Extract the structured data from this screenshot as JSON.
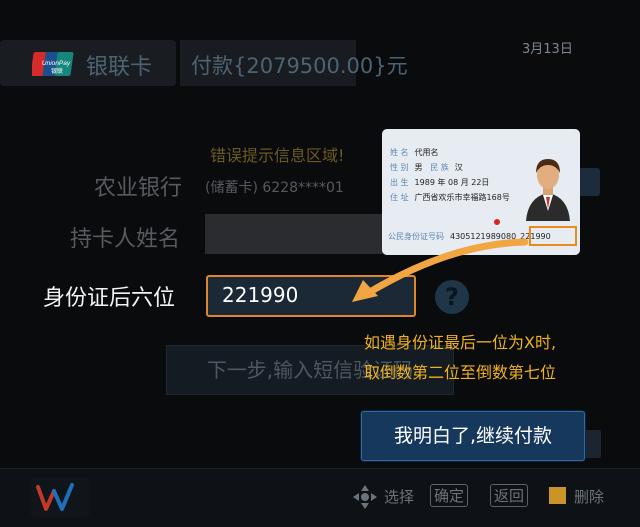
{
  "header": {
    "date": "3月13日",
    "card_label": "银联卡",
    "amount_text": "付款{2079500.00}元",
    "unionpay_logo_text": "UnionPay 银联"
  },
  "form": {
    "error_message": "错误提示信息区域!",
    "bank_label": "农业银行",
    "card_type": "(储蓄卡) 6228****01",
    "name_label": "持卡人姓名",
    "id_label": "身份证后六位",
    "id_value": "221990",
    "help_icon": "?",
    "next_button": "下一步,输入短信验证码"
  },
  "tooltip": {
    "line1": "如遇身份证最后一位为X时,",
    "line2": "取倒数第二位至倒数第七位",
    "confirm_button": "我明白了,继续付款"
  },
  "id_card": {
    "name_label": "姓 名",
    "name_value": "代用名",
    "sex_label": "性 别",
    "sex_value": "男",
    "ethnic_label": "民 族",
    "ethnic_value": "汉",
    "birth_label": "出 生",
    "birth_value": "1989 年 08 月 22日",
    "address_label": "住 址",
    "address_value": "广西省欢乐市幸福路168号",
    "number_label": "公民身份证号码",
    "number_value": "4305121989080",
    "number_tail": "221990"
  },
  "footer": {
    "select": "选择",
    "confirm": "确定",
    "back": "返回",
    "delete": "删除"
  },
  "colors": {
    "accent_orange": "#e0862a",
    "tip_yellow": "#f0b21e",
    "confirm_blue": "#15385c"
  }
}
